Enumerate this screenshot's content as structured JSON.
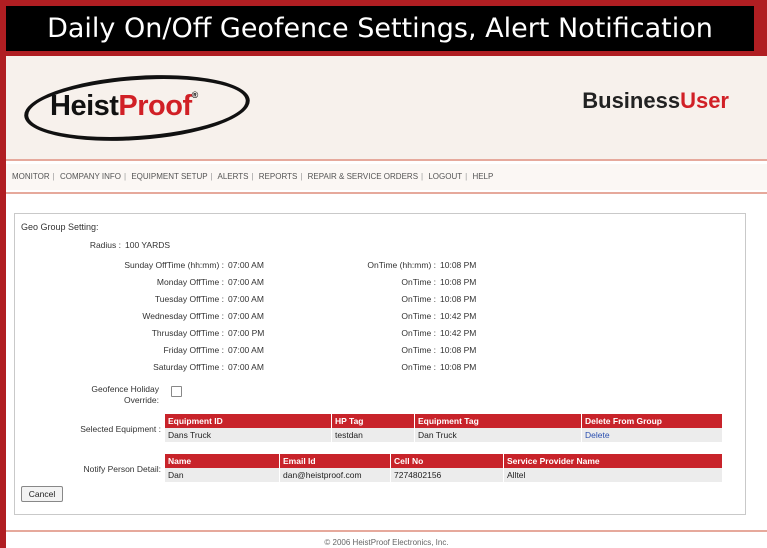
{
  "banner": {
    "title": "Daily On/Off Geofence Settings, Alert Notification"
  },
  "header": {
    "logo": {
      "text_black": "Heist",
      "text_red": "Proof",
      "reg": "®"
    },
    "business_user": {
      "black": "Business",
      "red": "User"
    }
  },
  "nav": {
    "items": [
      "MONITOR",
      "COMPANY INFO",
      "EQUIPMENT SETUP",
      "ALERTS",
      "REPORTS",
      "REPAIR & SERVICE ORDERS",
      "LOGOUT",
      "HELP"
    ],
    "separator": "|"
  },
  "geo_group": {
    "section_title": "Geo Group Setting:",
    "radius_label": "Radius :",
    "radius_value": "100 YARDS",
    "schedule": [
      {
        "off_label": "Sunday OffTime (hh:mm) :",
        "off_time": "07:00 AM",
        "on_label": "OnTime (hh:mm) :",
        "on_time": "10:08 PM"
      },
      {
        "off_label": "Monday OffTime :",
        "off_time": "07:00 AM",
        "on_label": "OnTime :",
        "on_time": "10:08 PM"
      },
      {
        "off_label": "Tuesday OffTime :",
        "off_time": "07:00 AM",
        "on_label": "OnTime :",
        "on_time": "10:08 PM"
      },
      {
        "off_label": "Wednesday OffTime :",
        "off_time": "07:00 AM",
        "on_label": "OnTime :",
        "on_time": "10:42 PM"
      },
      {
        "off_label": "Thrusday OffTime :",
        "off_time": "07:00 PM",
        "on_label": "OnTime :",
        "on_time": "10:42 PM"
      },
      {
        "off_label": "Friday OffTime :",
        "off_time": "07:00 AM",
        "on_label": "OnTime :",
        "on_time": "10:08 PM"
      },
      {
        "off_label": "Saturday OffTime :",
        "off_time": "07:00 AM",
        "on_label": "OnTime :",
        "on_time": "10:08 PM"
      }
    ],
    "holiday_label_line1": "Geofence Holiday",
    "holiday_label_line2": "Override:",
    "selected_equipment_label": "Selected Equipment :",
    "equipment_headers": [
      "Equipment ID",
      "HP Tag",
      "Equipment Tag",
      "Delete From Group"
    ],
    "equipment_row": [
      "Dans Truck",
      "testdan",
      "Dan Truck",
      "Delete"
    ],
    "notify_label": "Notify Person Detail:",
    "notify_headers": [
      "Name",
      "Email Id",
      "Cell No",
      "Service Provider Name"
    ],
    "notify_row": [
      "Dan",
      "dan@heistproof.com",
      "7274802156",
      "Alltel"
    ],
    "cancel_label": "Cancel"
  },
  "footer": {
    "copyright": "© 2006 HeistProof Electronics, Inc."
  },
  "colors": {
    "accent": "#c8232a",
    "frame": "#b01e22",
    "banner_bg": "#000000"
  }
}
